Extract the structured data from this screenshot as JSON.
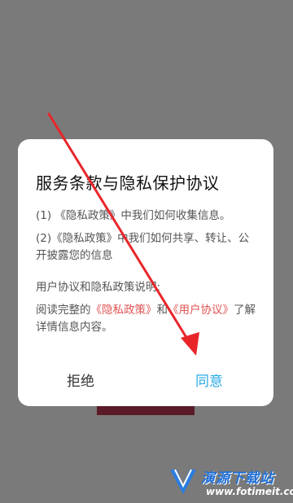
{
  "dialog": {
    "title": "服务条款与隐私保护协议",
    "item1": "(1) 《隐私政策》中我们如何收集信息。",
    "item2": "(2)《隐私政策》中我们如何共享、转让、公开披露您的信息",
    "section_title": "用户协议和隐私政策说明:",
    "read_prefix": "阅读完整的",
    "privacy_link": "《隐私政策》",
    "and_text": "和",
    "user_link": "《用户协议》",
    "read_suffix": "了解详情信息内容。",
    "reject_label": "拒绝",
    "agree_label": "同意"
  },
  "watermark": {
    "title": "演源下载站",
    "url": "www.fotimeit.com"
  },
  "colors": {
    "accent": "#29a9e6",
    "link": "#e05353",
    "arrow": "#e8262a"
  }
}
